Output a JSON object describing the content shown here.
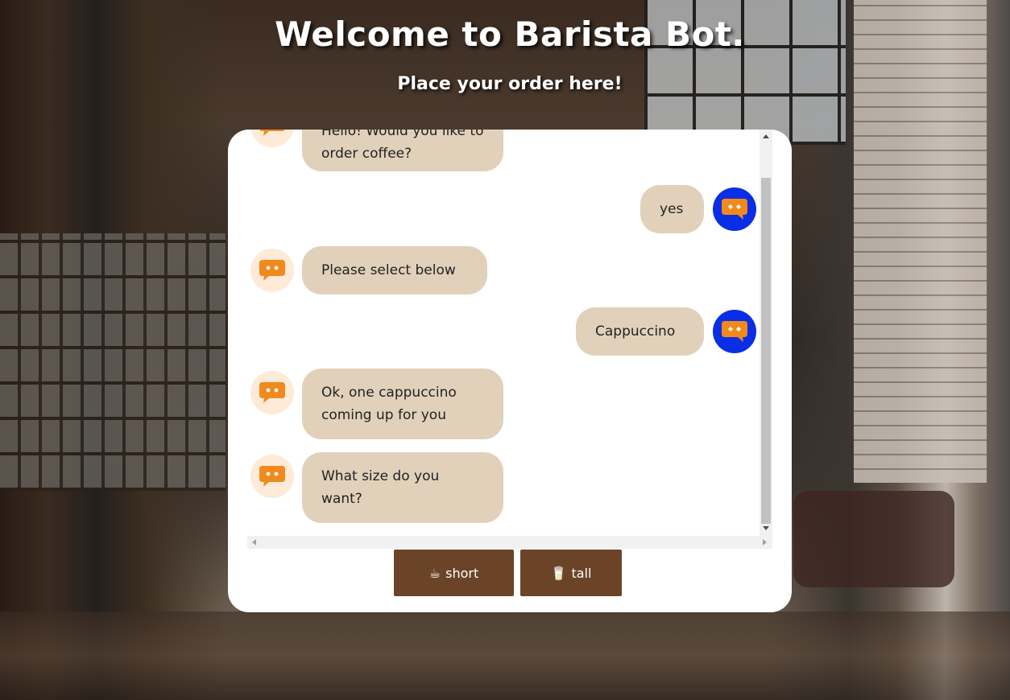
{
  "header": {
    "title": "Welcome to Barista Bot.",
    "subtitle": "Place your order here!"
  },
  "chat": {
    "messages": [
      {
        "sender": "bot",
        "text": "Hello! Would you like to order coffee?"
      },
      {
        "sender": "user",
        "text": "yes"
      },
      {
        "sender": "bot",
        "text": "Please select below"
      },
      {
        "sender": "user",
        "text": "Cappuccino"
      },
      {
        "sender": "bot",
        "text": "Ok, one cappuccino coming up for you"
      },
      {
        "sender": "bot",
        "text": "What size do you want?"
      }
    ]
  },
  "choices": {
    "short_label": "short",
    "short_icon": "☕",
    "tall_label": "tall",
    "tall_icon": "🥛"
  },
  "colors": {
    "bubble": "#e1d1bb",
    "user_avatar": "#0a2ee6",
    "bot_avatar_bg": "#fdebd8",
    "bot_icon": "#f08a1c",
    "button": "#6b4427"
  }
}
